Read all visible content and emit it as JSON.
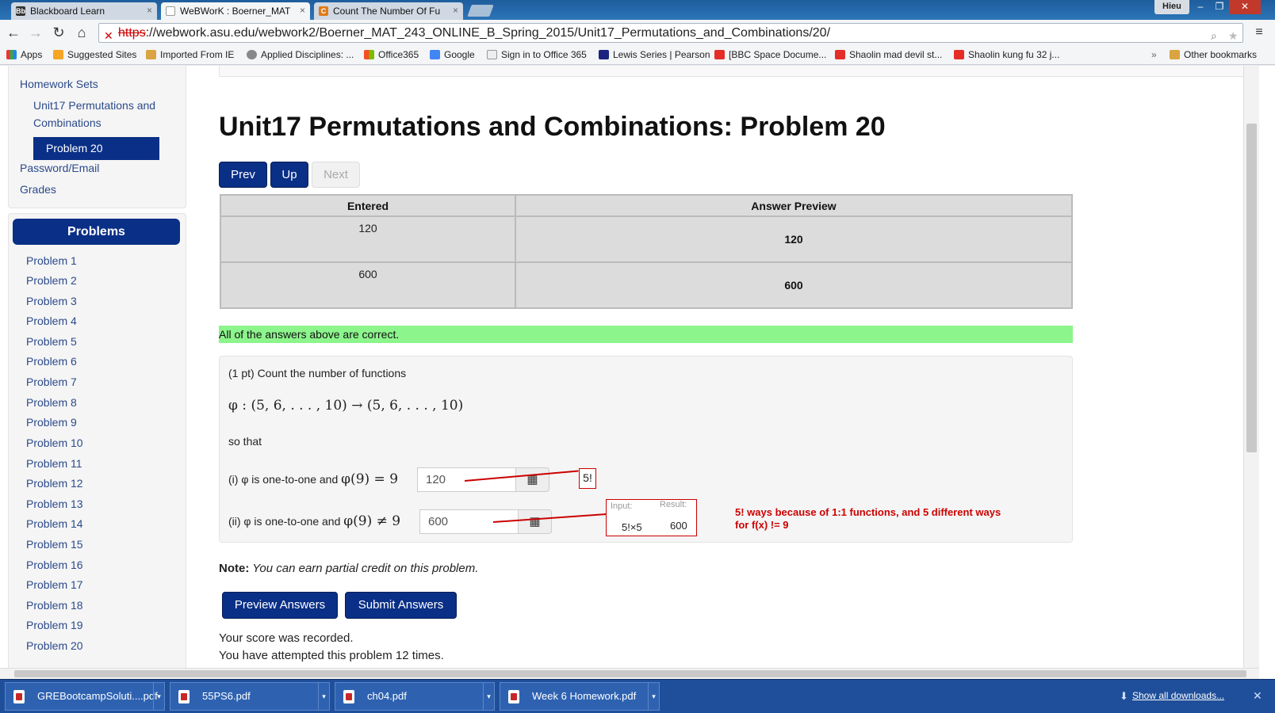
{
  "browser": {
    "tabs": [
      {
        "title": "Blackboard Learn",
        "favicon": "Bb"
      },
      {
        "title": "WeBWorK : Boerner_MAT",
        "favicon": ""
      },
      {
        "title": "Count The Number Of Fu",
        "favicon": "C"
      }
    ],
    "user": "Hieu",
    "url_scheme": "https",
    "url_rest": "://webwork.asu.edu/webwork2/Boerner_MAT_243_ONLINE_B_Spring_2015/Unit17_Permutations_and_Combinations/20/",
    "bookmarks": [
      "Apps",
      "Suggested Sites",
      "Imported From IE",
      "Applied Disciplines: ...",
      "Office365",
      "Google",
      "Sign in to Office 365",
      "Lewis Series | Pearson",
      "[BBC Space Docume...",
      "Shaolin mad devil st...",
      "Shaolin kung fu 32 j...",
      "Other bookmarks"
    ],
    "overflow": "»"
  },
  "sidebar": {
    "homework_sets": "Homework Sets",
    "unit_line1": "Unit17 Permutations and",
    "unit_line2": "Combinations",
    "active": "Problem 20",
    "password": "Password/Email",
    "grades": "Grades",
    "problems_title": "Problems",
    "problems": [
      "Problem 1",
      "Problem 2",
      "Problem 3",
      "Problem 4",
      "Problem 5",
      "Problem 6",
      "Problem 7",
      "Problem 8",
      "Problem 9",
      "Problem 10",
      "Problem 11",
      "Problem 12",
      "Problem 13",
      "Problem 14",
      "Problem 15",
      "Problem 16",
      "Problem 17",
      "Problem 18",
      "Problem 19",
      "Problem 20"
    ]
  },
  "main": {
    "title": "Unit17 Permutations and Combinations: Problem 20",
    "prev": "Prev",
    "up": "Up",
    "next": "Next",
    "table_headers": [
      "Entered",
      "Answer Preview"
    ],
    "rows": [
      {
        "entered": "120",
        "preview": "120"
      },
      {
        "entered": "600",
        "preview": "600"
      }
    ],
    "correct_msg": "All of the answers above are correct.",
    "problem": {
      "intro": "(1 pt) Count the number of functions",
      "formula": "φ : (5, 6, . . . , 10) → (5, 6, . . . , 10)",
      "so_that": "so that",
      "part1_prefix": "(i) φ is one-to-one and ",
      "part1_math": "φ(9) = 9",
      "part1_value": "120",
      "part2_prefix": "(ii) φ is one-to-one and ",
      "part2_math": "φ(9) ≠ 9",
      "part2_value": "600",
      "annot_factorial": "5!",
      "input_label": "Input:",
      "result_label": "Result:",
      "input_val": "5!×5",
      "result_val": "600",
      "annotation_line1": "5! ways because of 1:1 functions, and 5 different ways",
      "annotation_line2": "for f(x) != 9"
    },
    "note_label": "Note:",
    "note_text": " You can earn partial credit on this problem.",
    "preview_btn": "Preview Answers",
    "submit_btn": "Submit Answers",
    "score_msg": "Your score was recorded.",
    "attempts_msg": "You have attempted this problem 12 times."
  },
  "downloads": {
    "files": [
      "GREBootcampSoluti....pdf",
      "55PS6.pdf",
      "ch04.pdf",
      "Week 6 Homework.pdf"
    ],
    "show_all": "Show all downloads..."
  },
  "colors": {
    "accent": "#0a2f86",
    "correct": "#8cf58c",
    "annotation": "#cc0000"
  }
}
